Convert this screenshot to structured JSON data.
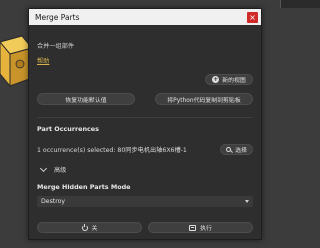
{
  "dialog": {
    "title": "Merge Parts",
    "close_label": "×",
    "description": "合并一组部件",
    "link": "帮助",
    "new_view_button": "新的视图",
    "reset_button": "恢复功能默认值",
    "copy_python_button": "将Python代码复制到剪贴板",
    "occurrences_title": "Part Occurrences",
    "occurrences_text": "1 occurrence(s) selected: 80同步电机出轴6X6槽-1-sol...",
    "select_button": "选择",
    "advanced_label": "高级",
    "merge_mode_title": "Merge Hidden Parts Mode",
    "merge_mode_value": "Destroy",
    "close_button": "关",
    "execute_button": "执行"
  },
  "icons": {
    "new_view": "plus-circle-icon",
    "select": "search-icon",
    "advanced": "chevron-down-icon",
    "dropdown": "caret-down-icon",
    "close": "power-icon",
    "execute": "execute-icon"
  },
  "colors": {
    "link": "#d9b34a",
    "close_button_bg": "#d12a2a",
    "dialog_bg": "#2e2e2e",
    "model_fill": "#e6b43c"
  }
}
